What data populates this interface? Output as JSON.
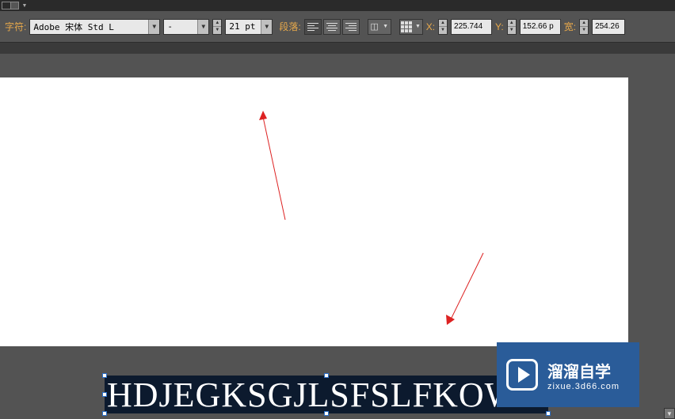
{
  "labels": {
    "char": "字符:",
    "para": "段落:",
    "x": "X:",
    "y": "Y:",
    "w": "宽:"
  },
  "font": {
    "family": "Adobe 宋体 Std L",
    "style": "-",
    "size": "21 pt"
  },
  "transform": {
    "x": "225.744",
    "y": "152.66 p",
    "w": "254.26"
  },
  "canvas": {
    "text": "HDJEGKSGJLSFSLFKOWEJF"
  },
  "watermark": {
    "name": "溜溜自学",
    "url": "zixue.3d66.com"
  }
}
